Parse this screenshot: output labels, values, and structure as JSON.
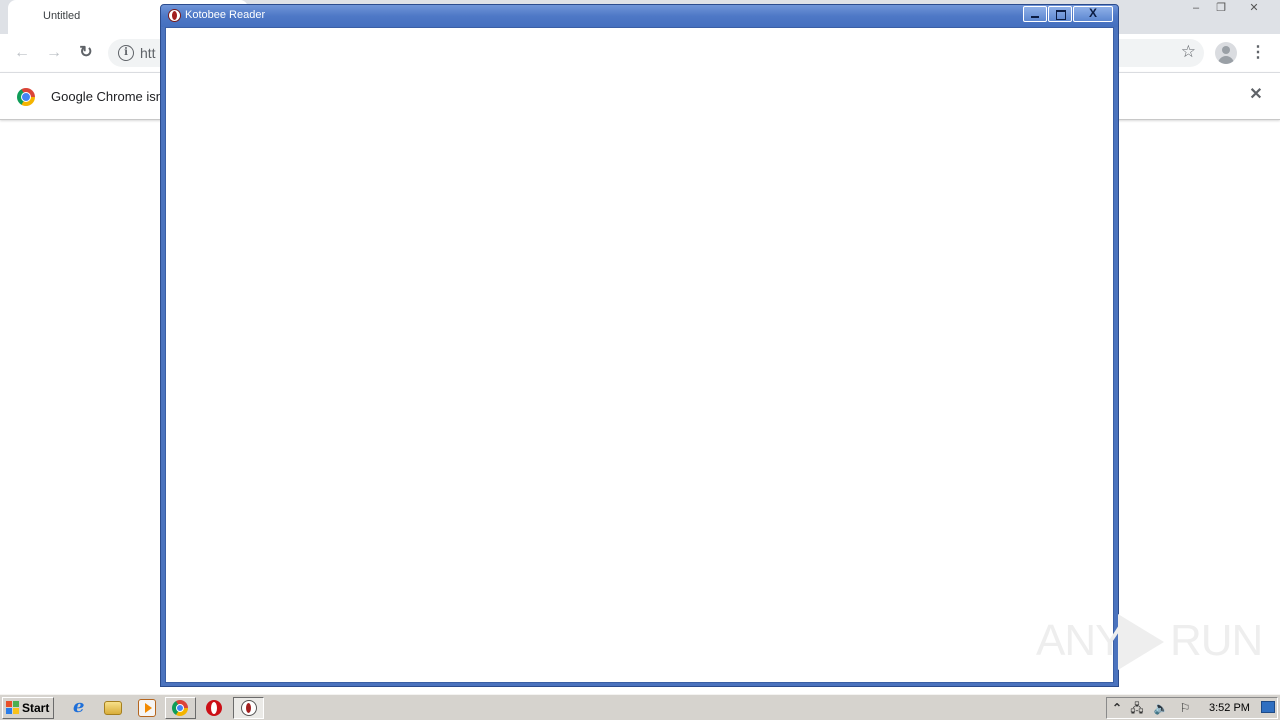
{
  "chrome": {
    "tab_title": "Untitled",
    "address_text": "htt",
    "infobar_text": "Google Chrome isn't",
    "window_controls": [
      "minimize-icon",
      "restore-icon",
      "close-icon"
    ],
    "nav_icons": [
      "back-arrow-icon",
      "forward-arrow-icon",
      "reload-icon"
    ],
    "min_glyph": "–",
    "restore_glyph": "❐",
    "close_glyph": "✕",
    "back_glyph": "←",
    "forward_glyph": "→",
    "reload_glyph": "↻",
    "info_glyph": "i",
    "star_glyph": "☆",
    "menu_glyph": "⋮",
    "infobar_close_glyph": "✕"
  },
  "kotobee_window": {
    "title": "Kotobee Reader",
    "close_glyph": "X",
    "titlebar_color": "#4e78c6",
    "content_color": "#ffffff"
  },
  "watermark": {
    "left": "ANY",
    "right": "RUN"
  },
  "taskbar": {
    "start_label": "Start",
    "clock": "3:52 PM",
    "quick_launch": [
      "internet-explorer-icon",
      "windows-explorer-icon",
      "media-player-icon"
    ],
    "tasks": [
      "google-chrome",
      "opera",
      "kotobee-reader"
    ],
    "tray_icons": [
      "show-hidden-icons",
      "network-icon",
      "volume-icon",
      "action-center-flag-icon"
    ],
    "tray_expand_glyph": "⌃",
    "network_glyph": "🖧",
    "volume_glyph": "🔈",
    "flag_glyph": "⚐"
  }
}
